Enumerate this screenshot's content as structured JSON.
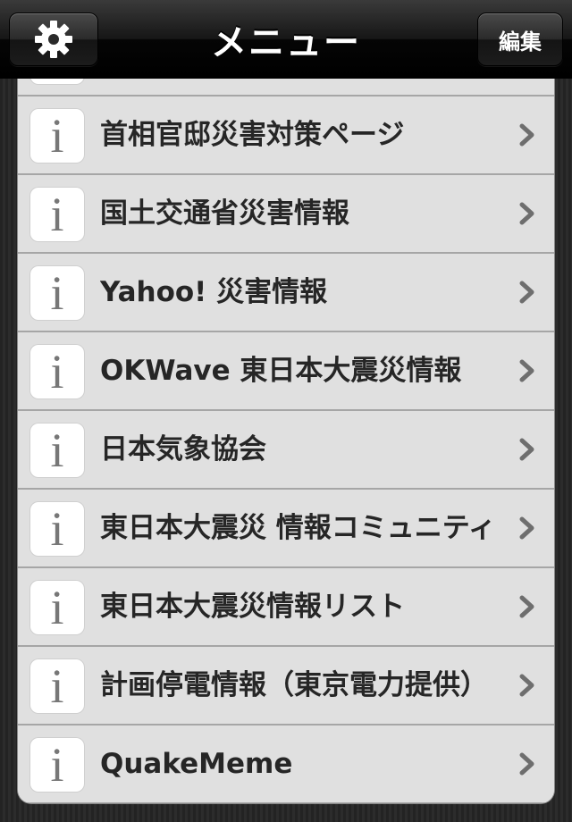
{
  "navbar": {
    "title": "メニュー",
    "edit_label": "編集",
    "settings_icon": "gear-icon"
  },
  "menu": {
    "items": [
      {
        "label": "",
        "icon": "info-icon"
      },
      {
        "label": "首相官邸災害対策ページ",
        "icon": "info-icon"
      },
      {
        "label": "国土交通省災害情報",
        "icon": "info-icon"
      },
      {
        "label": "Yahoo! 災害情報",
        "icon": "info-icon"
      },
      {
        "label": "OKWave 東日本大震災情報",
        "icon": "info-icon"
      },
      {
        "label": "日本気象協会",
        "icon": "info-icon"
      },
      {
        "label": "東日本大震災 情報コミュニティ",
        "icon": "info-icon"
      },
      {
        "label": "東日本大震災情報リスト",
        "icon": "info-icon"
      },
      {
        "label": "計画停電情報（東京電力提供）",
        "icon": "info-icon"
      },
      {
        "label": "QuakeMeme",
        "icon": "info-icon"
      }
    ]
  },
  "colors": {
    "row_bg": "#e0e0e0",
    "row_divider": "#a6a6a6",
    "label_text": "#262626",
    "navbar_bg": "#000000"
  }
}
